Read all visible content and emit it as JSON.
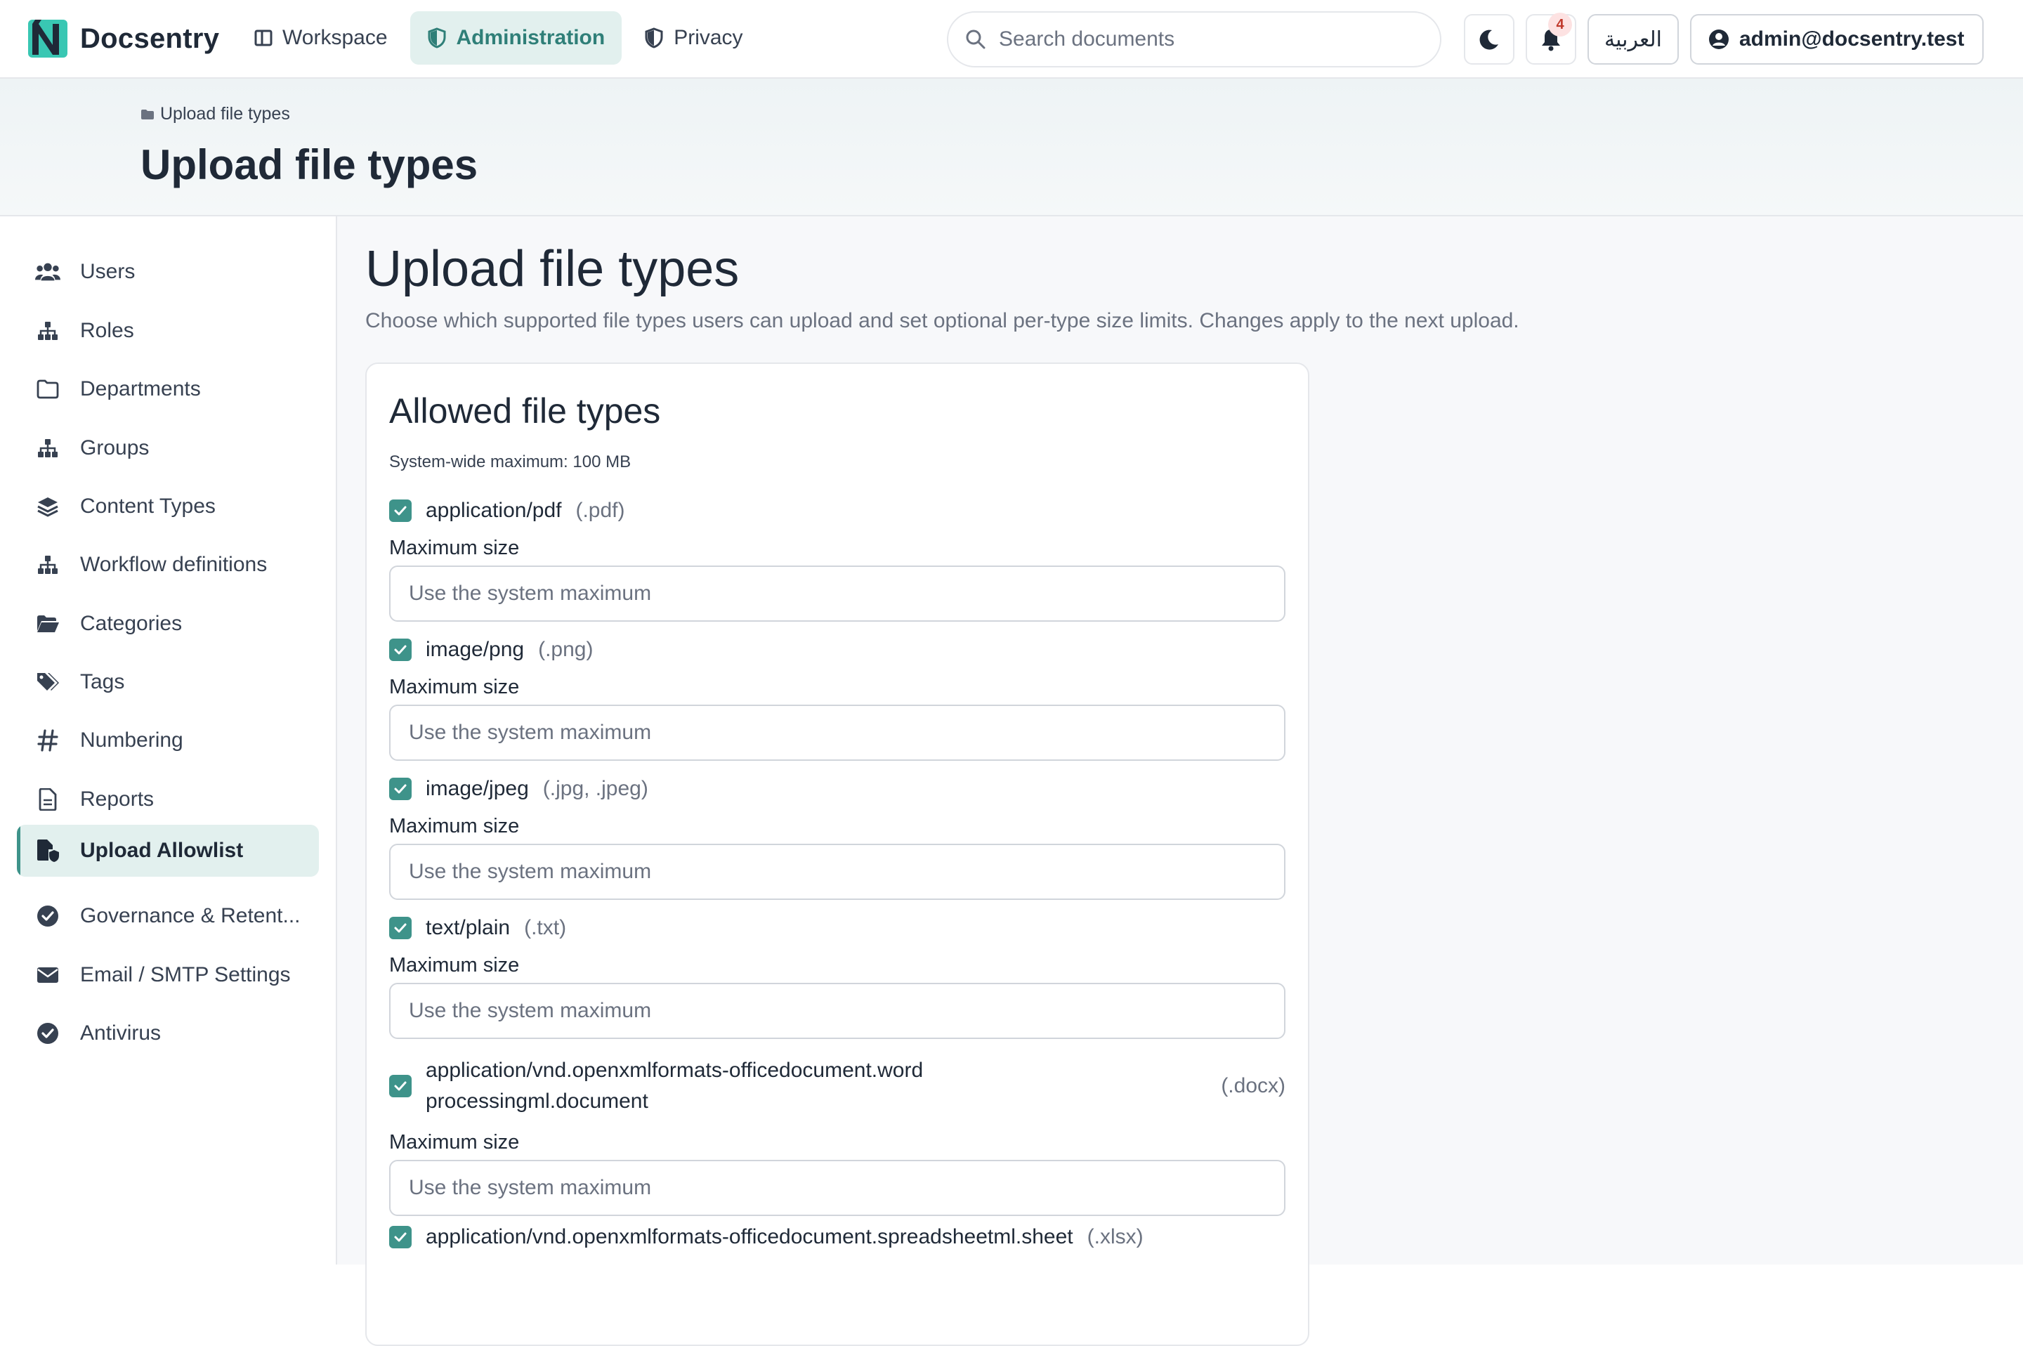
{
  "app": {
    "name": "Docsentry"
  },
  "nav": {
    "workspace": "Workspace",
    "administration": "Administration",
    "privacy": "Privacy"
  },
  "search": {
    "placeholder": "Search documents"
  },
  "notifications": {
    "count": "4"
  },
  "language_toggle": "العربية",
  "user": {
    "email": "admin@docsentry.test"
  },
  "breadcrumb": {
    "current": "Upload file types"
  },
  "page_title": "Upload file types",
  "sidebar": {
    "items": [
      {
        "label": "Users",
        "icon": "users-icon"
      },
      {
        "label": "Roles",
        "icon": "sitemap-icon"
      },
      {
        "label": "Departments",
        "icon": "folder-icon"
      },
      {
        "label": "Groups",
        "icon": "sitemap-icon"
      },
      {
        "label": "Content Types",
        "icon": "layers-icon"
      },
      {
        "label": "Workflow definitions",
        "icon": "sitemap-icon"
      },
      {
        "label": "Categories",
        "icon": "folder-open-icon"
      },
      {
        "label": "Tags",
        "icon": "tags-icon"
      },
      {
        "label": "Numbering",
        "icon": "hash-icon"
      },
      {
        "label": "Reports",
        "icon": "file-icon"
      },
      {
        "label": "Upload Allowlist",
        "icon": "file-shield-icon",
        "active": true
      },
      {
        "label": "Governance & Retent...",
        "icon": "check-circle-icon"
      },
      {
        "label": "Email / SMTP Settings",
        "icon": "envelope-icon"
      },
      {
        "label": "Antivirus",
        "icon": "check-circle-icon"
      }
    ]
  },
  "main": {
    "title": "Upload file types",
    "description": "Choose which supported file types users can upload and set optional per-type size limits. Changes apply to the next upload."
  },
  "card": {
    "title": "Allowed file types",
    "system_max": "System-wide maximum: 100 MB",
    "size_label": "Maximum size",
    "size_placeholder": "Use the system maximum",
    "file_types": [
      {
        "mime": "application/pdf",
        "ext": "(.pdf)",
        "checked": true
      },
      {
        "mime": "image/png",
        "ext": "(.png)",
        "checked": true
      },
      {
        "mime": "image/jpeg",
        "ext": "(.jpg, .jpeg)",
        "checked": true
      },
      {
        "mime": "text/plain",
        "ext": "(.txt)",
        "checked": true
      },
      {
        "mime": "application/vnd.openxmlformats-officedocument.wordprocessingml.document",
        "ext": "(.docx)",
        "checked": true
      },
      {
        "mime": "application/vnd.openxmlformats-officedocument.spreadsheetml.sheet",
        "ext": "(.xlsx)",
        "checked": true
      }
    ]
  },
  "colors": {
    "accent": "#3e938a",
    "accent_bg": "#e2f0ee",
    "badge": "#c0392b"
  }
}
